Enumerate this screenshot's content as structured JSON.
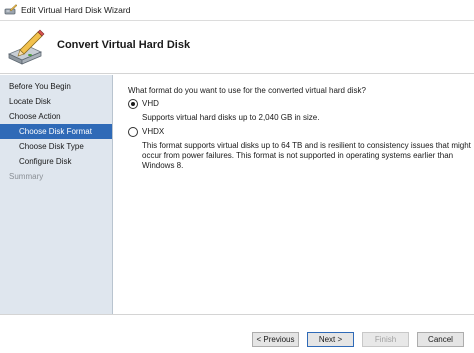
{
  "window": {
    "title": "Edit Virtual Hard Disk Wizard"
  },
  "header": {
    "heading": "Convert Virtual Hard Disk"
  },
  "sidebar": {
    "items": [
      {
        "label": "Before You Begin"
      },
      {
        "label": "Locate Disk"
      },
      {
        "label": "Choose Action"
      },
      {
        "label": "Choose Disk Format"
      },
      {
        "label": "Choose Disk Type"
      },
      {
        "label": "Configure Disk"
      },
      {
        "label": "Summary"
      }
    ]
  },
  "content": {
    "question": "What format do you want to use for the converted virtual hard disk?",
    "options": [
      {
        "label": "VHD",
        "description": "Supports virtual hard disks up to 2,040 GB in size.",
        "selected": true
      },
      {
        "label": "VHDX",
        "description": "This format supports virtual disks up to 64 TB and is resilient to consistency issues that might occur from power failures. This format is not supported in operating systems earlier than Windows 8.",
        "selected": false
      }
    ]
  },
  "footer": {
    "previous_label": "< Previous",
    "next_label": "Next >",
    "finish_label": "Finish",
    "cancel_label": "Cancel"
  },
  "colors": {
    "selected_step": "#2f6ab7",
    "sidebar_bg": "#dfe6ee"
  },
  "icons": {
    "title": "disk-wizard-icon",
    "header": "disk-pencil-icon"
  }
}
